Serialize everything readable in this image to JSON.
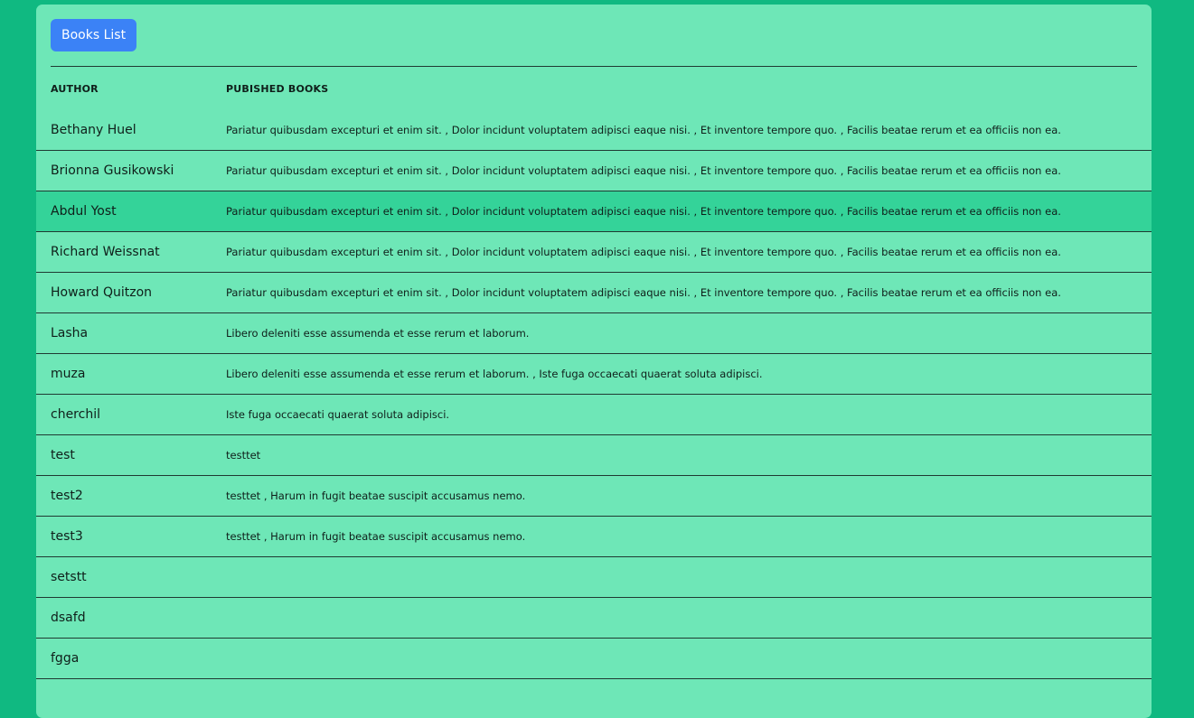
{
  "header": {
    "button_label": "Books List"
  },
  "table": {
    "columns": [
      "AUTHOR",
      "PUBISHED BOOKS"
    ],
    "rows": [
      {
        "author": "Bethany Huel",
        "books": "Pariatur quibusdam excepturi et enim sit. , Dolor incidunt voluptatem adipisci eaque nisi. , Et inventore tempore quo. , Facilis beatae rerum et ea officiis non ea."
      },
      {
        "author": "Brionna Gusikowski",
        "books": "Pariatur quibusdam excepturi et enim sit. , Dolor incidunt voluptatem adipisci eaque nisi. , Et inventore tempore quo. , Facilis beatae rerum et ea officiis non ea."
      },
      {
        "author": "Abdul Yost",
        "books": "Pariatur quibusdam excepturi et enim sit. , Dolor incidunt voluptatem adipisci eaque nisi. , Et inventore tempore quo. , Facilis beatae rerum et ea officiis non ea.",
        "highlighted": true
      },
      {
        "author": "Richard Weissnat",
        "books": "Pariatur quibusdam excepturi et enim sit. , Dolor incidunt voluptatem adipisci eaque nisi. , Et inventore tempore quo. , Facilis beatae rerum et ea officiis non ea."
      },
      {
        "author": "Howard Quitzon",
        "books": "Pariatur quibusdam excepturi et enim sit. , Dolor incidunt voluptatem adipisci eaque nisi. , Et inventore tempore quo. , Facilis beatae rerum et ea officiis non ea."
      },
      {
        "author": "Lasha",
        "books": "Libero deleniti esse assumenda et esse rerum et laborum."
      },
      {
        "author": "muza",
        "books": "Libero deleniti esse assumenda et esse rerum et laborum. , Iste fuga occaecati quaerat soluta adipisci."
      },
      {
        "author": "cherchil",
        "books": "Iste fuga occaecati quaerat soluta adipisci."
      },
      {
        "author": "test",
        "books": "testtet"
      },
      {
        "author": "test2",
        "books": "testtet , Harum in fugit beatae suscipit accusamus nemo."
      },
      {
        "author": "test3",
        "books": "testtet , Harum in fugit beatae suscipit accusamus nemo."
      },
      {
        "author": "setstt",
        "books": ""
      },
      {
        "author": "dsafd",
        "books": ""
      },
      {
        "author": "fgga",
        "books": ""
      },
      {
        "author": "",
        "books": ""
      }
    ]
  },
  "colors": {
    "page_background": "#10b981",
    "card_background": "#6ee7b7",
    "row_highlight": "#34d399",
    "button_background": "#3b82f6",
    "button_text": "#ffffff",
    "divider": "#1f3a32"
  }
}
